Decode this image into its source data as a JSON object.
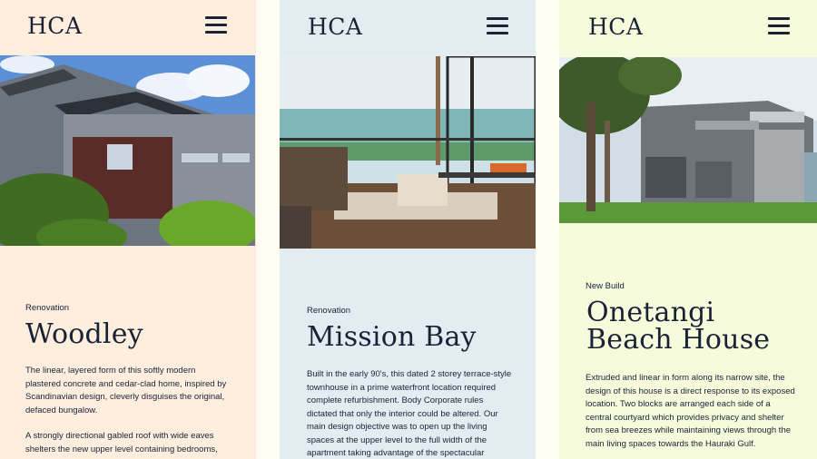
{
  "panels": [
    {
      "logo": "HCA",
      "category": "Renovation",
      "title": "Woodley",
      "paragraph1": "The linear, layered form of this softly modern plastered concrete and cedar-clad home, inspired by Scandinavian design, cleverly disguises the original, defaced bungalow.",
      "paragraph2": "A strongly directional gabled roof with wide eaves shelters the new upper level containing bedrooms,",
      "menu_icon": "hamburger-menu-icon"
    },
    {
      "logo": "HCA",
      "category": "Renovation",
      "title": "Mission Bay",
      "paragraph1": "Built in the early 90's, this dated 2 storey terrace-style townhouse in a prime waterfront location required complete refurbishment. Body Corporate rules dictated that only the interior could be altered. Our main design objective was to open up the living spaces at the upper level to the full width of the apartment taking advantage of the spectacular",
      "menu_icon": "hamburger-menu-icon"
    },
    {
      "logo": "HCA",
      "category": "New Build",
      "title_line1": "Onetangi",
      "title_line2": "Beach House",
      "paragraph1": "Extruded and linear in form along its narrow site, the design of this house is a direct response to its exposed location. Two blocks are arranged each side of a central courtyard which provides privacy and shelter from sea breezes while maintaining views through the main living spaces towards the Hauraki Gulf.",
      "menu_icon": "hamburger-menu-icon"
    }
  ],
  "colors": {
    "panel1_bg": "#fdeede",
    "panel2_bg": "#e3ecf1",
    "panel3_bg": "#f6fbdc",
    "text": "#1a2238"
  }
}
